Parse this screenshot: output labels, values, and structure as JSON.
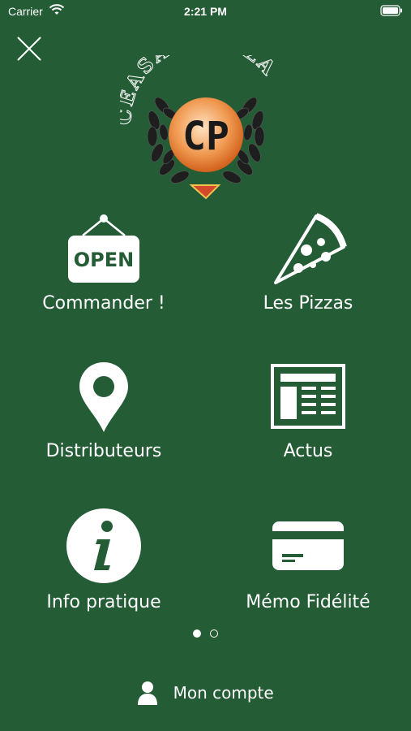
{
  "status_bar": {
    "carrier": "Carrier",
    "time": "2:21 PM"
  },
  "logo": {
    "brand_text": "CEASAR PIZZA",
    "monogram": "CP"
  },
  "menu": {
    "order": {
      "label": "Commander !",
      "sign_text": "OPEN"
    },
    "pizzas": {
      "label": "Les Pizzas"
    },
    "distributors": {
      "label": "Distributeurs"
    },
    "news": {
      "label": "Actus"
    },
    "info": {
      "label": "Info pratique"
    },
    "loyalty": {
      "label": "Mémo Fidélité"
    }
  },
  "pager": {
    "count": 2,
    "active_index": 0
  },
  "account": {
    "label": "Mon compte"
  },
  "colors": {
    "background": "#235c35",
    "foreground": "#ffffff",
    "logo_orange": "#e8772a"
  }
}
